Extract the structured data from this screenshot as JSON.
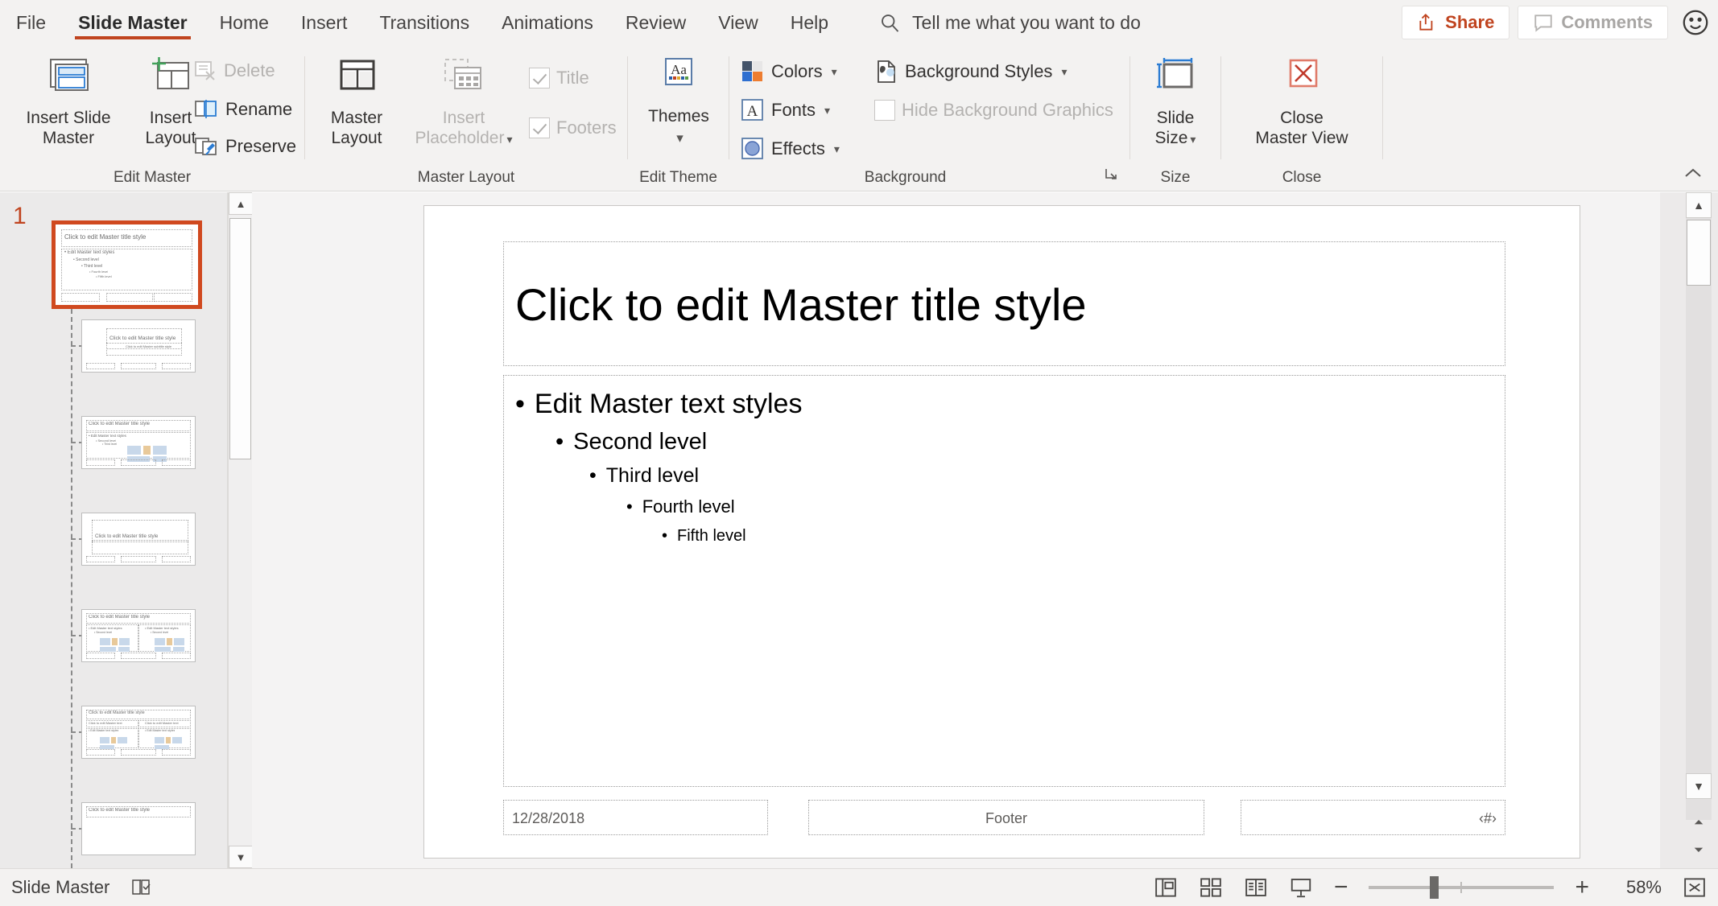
{
  "app": {
    "tabs": [
      {
        "label": "File",
        "active": false
      },
      {
        "label": "Slide Master",
        "active": true
      },
      {
        "label": "Home",
        "active": false
      },
      {
        "label": "Insert",
        "active": false
      },
      {
        "label": "Transitions",
        "active": false
      },
      {
        "label": "Animations",
        "active": false
      },
      {
        "label": "Review",
        "active": false
      },
      {
        "label": "View",
        "active": false
      },
      {
        "label": "Help",
        "active": false
      }
    ],
    "tell_me": "Tell me what you want to do",
    "share_label": "Share",
    "comments_label": "Comments",
    "accent_color": "#c0441f",
    "ribbon_bg": "#f3f2f1"
  },
  "ribbon": {
    "groups": [
      {
        "name": "Edit Master",
        "label": "Edit Master",
        "buttons": [
          {
            "label": "Insert Slide\nMaster",
            "line1": "Insert Slide",
            "line2": "Master",
            "disabled": false
          },
          {
            "label": "Insert\nLayout",
            "line1": "Insert",
            "line2": "Layout",
            "disabled": false
          }
        ],
        "small_buttons": [
          {
            "label": "Delete",
            "disabled": true
          },
          {
            "label": "Rename",
            "disabled": false
          },
          {
            "label": "Preserve",
            "disabled": false
          }
        ]
      },
      {
        "name": "Master Layout",
        "label": "Master Layout",
        "buttons": [
          {
            "line1": "Master",
            "line2": "Layout",
            "disabled": false
          },
          {
            "line1": "Insert",
            "line2": "Placeholder",
            "disabled": true,
            "has_caret": true
          }
        ],
        "checkboxes": [
          {
            "label": "Title",
            "checked": true,
            "disabled": true
          },
          {
            "label": "Footers",
            "checked": true,
            "disabled": true
          }
        ]
      },
      {
        "name": "Edit Theme",
        "label": "Edit Theme",
        "buttons": [
          {
            "line1": "Themes",
            "line2": "",
            "has_caret": true
          }
        ]
      },
      {
        "name": "Background",
        "label": "Background",
        "small_buttons": [
          {
            "label": "Colors",
            "has_caret": true,
            "disabled": false
          },
          {
            "label": "Fonts",
            "has_caret": true,
            "disabled": false
          },
          {
            "label": "Effects",
            "has_caret": true,
            "disabled": false
          },
          {
            "label": "Background Styles",
            "has_caret": true,
            "disabled": false
          }
        ],
        "checkboxes": [
          {
            "label": "Hide Background Graphics",
            "checked": false,
            "disabled": true
          }
        ],
        "has_dialog_launcher": true
      },
      {
        "name": "Size",
        "label": "Size",
        "buttons": [
          {
            "line1": "Slide",
            "line2": "Size",
            "has_caret": true
          }
        ]
      },
      {
        "name": "Close",
        "label": "Close",
        "buttons": [
          {
            "line1": "Close",
            "line2": "Master View"
          }
        ]
      }
    ]
  },
  "thumbnails": {
    "slide_number": "1",
    "items": [
      {
        "index": 1,
        "selected": true,
        "kind": "master",
        "title": "Click to edit Master title style"
      },
      {
        "index": 2,
        "selected": false,
        "kind": "title",
        "title": "Click to edit Master title style"
      },
      {
        "index": 3,
        "selected": false,
        "kind": "content",
        "title": "Click to edit Master title style"
      },
      {
        "index": 4,
        "selected": false,
        "kind": "section",
        "title": "Click to edit Master title style"
      },
      {
        "index": 5,
        "selected": false,
        "kind": "two-content",
        "title": "Click to edit Master title style"
      },
      {
        "index": 6,
        "selected": false,
        "kind": "comparison",
        "title": "Click to edit Master title style"
      },
      {
        "index": 7,
        "selected": false,
        "kind": "title-only",
        "title": "Click to edit Master title style"
      }
    ]
  },
  "slide": {
    "title_placeholder": "Click to edit Master title style",
    "body_levels": [
      {
        "level": 1,
        "text": "Edit Master text styles"
      },
      {
        "level": 2,
        "text": "Second level"
      },
      {
        "level": 3,
        "text": "Third level"
      },
      {
        "level": 4,
        "text": "Fourth level"
      },
      {
        "level": 5,
        "text": "Fifth level"
      }
    ],
    "date_placeholder": "12/28/2018",
    "footer_placeholder": "Footer",
    "slide_number_placeholder": "‹#›"
  },
  "status_bar": {
    "view_name": "Slide Master",
    "zoom_percent": "58%",
    "zoom_value": 58,
    "views": [
      "normal-view",
      "slide-sorter-view",
      "reading-view",
      "slideshow-view"
    ],
    "zoom_out_label": "−",
    "zoom_in_label": "+"
  }
}
